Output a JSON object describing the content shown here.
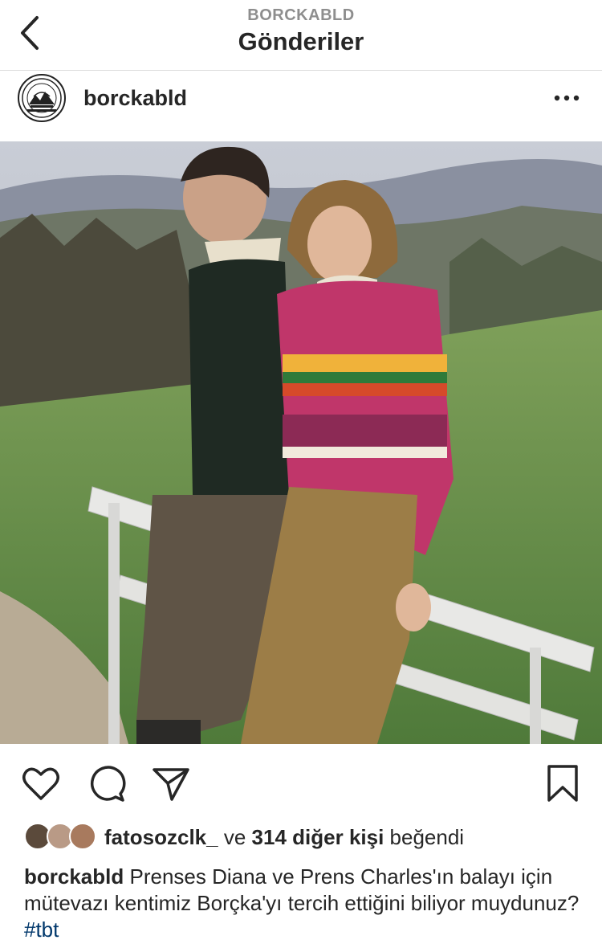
{
  "header": {
    "subtitle": "BORCKABLD",
    "title": "Gönderiler"
  },
  "post": {
    "username": "borckabld",
    "photo_description_icon": "photo"
  },
  "actions": {
    "like_icon": "heart-icon",
    "comment_icon": "comment-icon",
    "share_icon": "share-icon",
    "save_icon": "bookmark-icon"
  },
  "likes": {
    "first_user": "fatosozclk_",
    "connector": "ve",
    "others": "314 diğer kişi",
    "suffix": "beğendi"
  },
  "caption": {
    "username": "borckabld",
    "text": "Prenses Diana ve Prens Charles'ın balayı için mütevazı kentimiz Borçka'yı tercih ettiğini biliyor muydunuz?",
    "hashtag": "#tbt"
  }
}
